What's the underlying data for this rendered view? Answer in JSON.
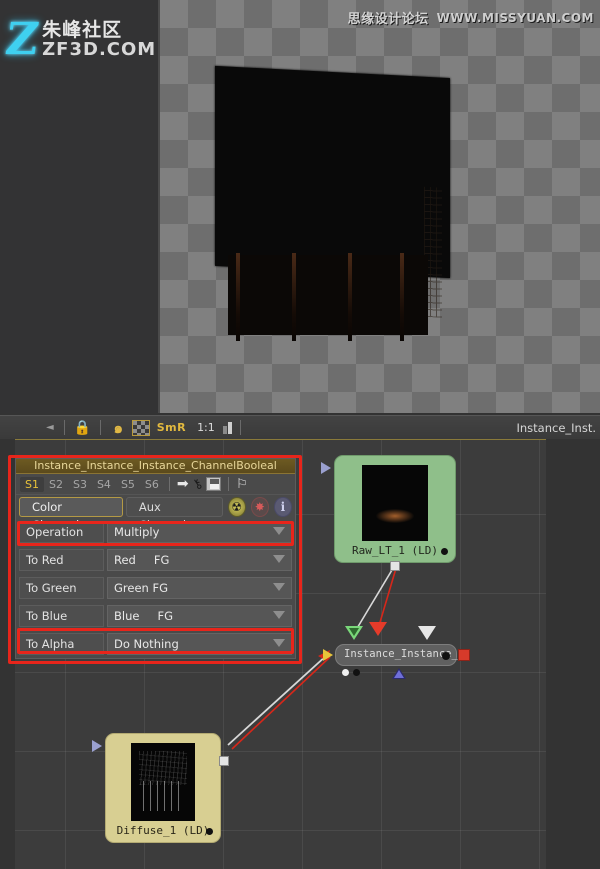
{
  "app": {
    "viewport_title": "Instance_Inst…"
  },
  "watermarks": {
    "left_logo": "Z",
    "left_cn": "朱峰社区",
    "left_en": "ZF3D.COM",
    "right_cn": "思缘设计论坛",
    "right_en": "WWW.MISSYUAN.COM"
  },
  "toolbar": {
    "collapse_arrow": "◄",
    "lock_icon": "lock-icon",
    "swirl_icon": "swirl-icon",
    "checker_icon": "checker-icon",
    "smr_label": "SmR",
    "ratio_label": "1:1",
    "bars_icon": "bars-icon",
    "node_name": "Instance_Inst."
  },
  "panel": {
    "title": "Instance_Instance_Instance_ChannelBooleal",
    "slots": [
      "S1",
      "S2",
      "S3",
      "S4",
      "S5",
      "S6"
    ],
    "active_slot": "S1",
    "tool_icons": [
      "arrow-right-icon",
      "key-icon",
      "save-disk-icon",
      "pin-icon"
    ],
    "arrow_glyph": "➡",
    "key_glyph": "⚷",
    "pin_glyph": "⚐",
    "tabs": [
      {
        "label": "Color Channels",
        "active": true
      },
      {
        "label": "Aux Channels",
        "active": false
      }
    ],
    "tab_icons": [
      {
        "name": "radiation-icon",
        "glyph": "☢"
      },
      {
        "name": "gear-icon",
        "glyph": "✸"
      },
      {
        "name": "info-icon",
        "glyph": "i"
      }
    ],
    "rows": [
      {
        "label": "Operation",
        "value": "Multiply",
        "value2": "",
        "highlighted": true
      },
      {
        "label": "To Red",
        "value": "Red",
        "value2": "FG",
        "highlighted": false
      },
      {
        "label": "To Green",
        "value": "Green FG",
        "value2": "",
        "highlighted": false
      },
      {
        "label": "To Blue",
        "value": "Blue",
        "value2": "FG",
        "highlighted": false
      },
      {
        "label": "To Alpha",
        "value": "Do Nothing",
        "value2": "",
        "highlighted": true
      }
    ]
  },
  "graph": {
    "nodes": [
      {
        "id": "raw",
        "label": "Raw_LT_1  (LD)",
        "color": "#8fbf8a"
      },
      {
        "id": "inst",
        "label": "Instance_Instance_…",
        "color": "#606060"
      },
      {
        "id": "diffuse",
        "label": "Diffuse_1  (LD)",
        "color": "#d8cf92"
      }
    ],
    "link_colors": {
      "white": "#d8d8d8",
      "red": "#d6271a"
    },
    "port_colors": {
      "green": "#7ad87a",
      "red": "#e53b2a",
      "white": "#e6e6e6",
      "yellow": "#e8c53a",
      "blue": "#6f6fd8"
    }
  },
  "colors": {
    "highlight": "#e8251b",
    "accent_gold": "#e8c23a",
    "panel_bg": "#4a4a4a",
    "graph_bg": "#3c3c3c"
  }
}
